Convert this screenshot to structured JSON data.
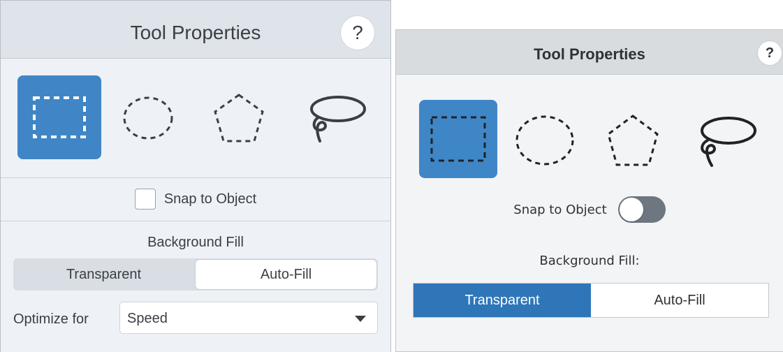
{
  "left_panel": {
    "title": "Tool Properties",
    "help_label": "?",
    "tools": [
      {
        "name": "rectangle-select",
        "selected": true
      },
      {
        "name": "ellipse-select",
        "selected": false
      },
      {
        "name": "polygon-select",
        "selected": false
      },
      {
        "name": "lasso-select",
        "selected": false
      }
    ],
    "snap_label": "Snap to Object",
    "snap_checked": false,
    "background_fill_title": "Background Fill",
    "background_fill_options": [
      "Transparent",
      "Auto-Fill"
    ],
    "background_fill_selected": "Auto-Fill",
    "optimize_label": "Optimize for",
    "optimize_value": "Speed"
  },
  "right_panel": {
    "title": "Tool Properties",
    "help_label": "?",
    "tools": [
      {
        "name": "rectangle-select",
        "selected": true
      },
      {
        "name": "ellipse-select",
        "selected": false
      },
      {
        "name": "polygon-select",
        "selected": false
      },
      {
        "name": "lasso-select",
        "selected": false
      }
    ],
    "snap_label": "Snap to Object",
    "snap_enabled": false,
    "background_fill_title": "Background Fill:",
    "background_fill_options": [
      "Transparent",
      "Auto-Fill"
    ],
    "background_fill_selected": "Transparent"
  },
  "colors": {
    "accent_left": "#4086c6",
    "accent_right": "#2f76b8",
    "panel_bg": "#eef2f7",
    "header_bg": "#dfe4ea"
  }
}
